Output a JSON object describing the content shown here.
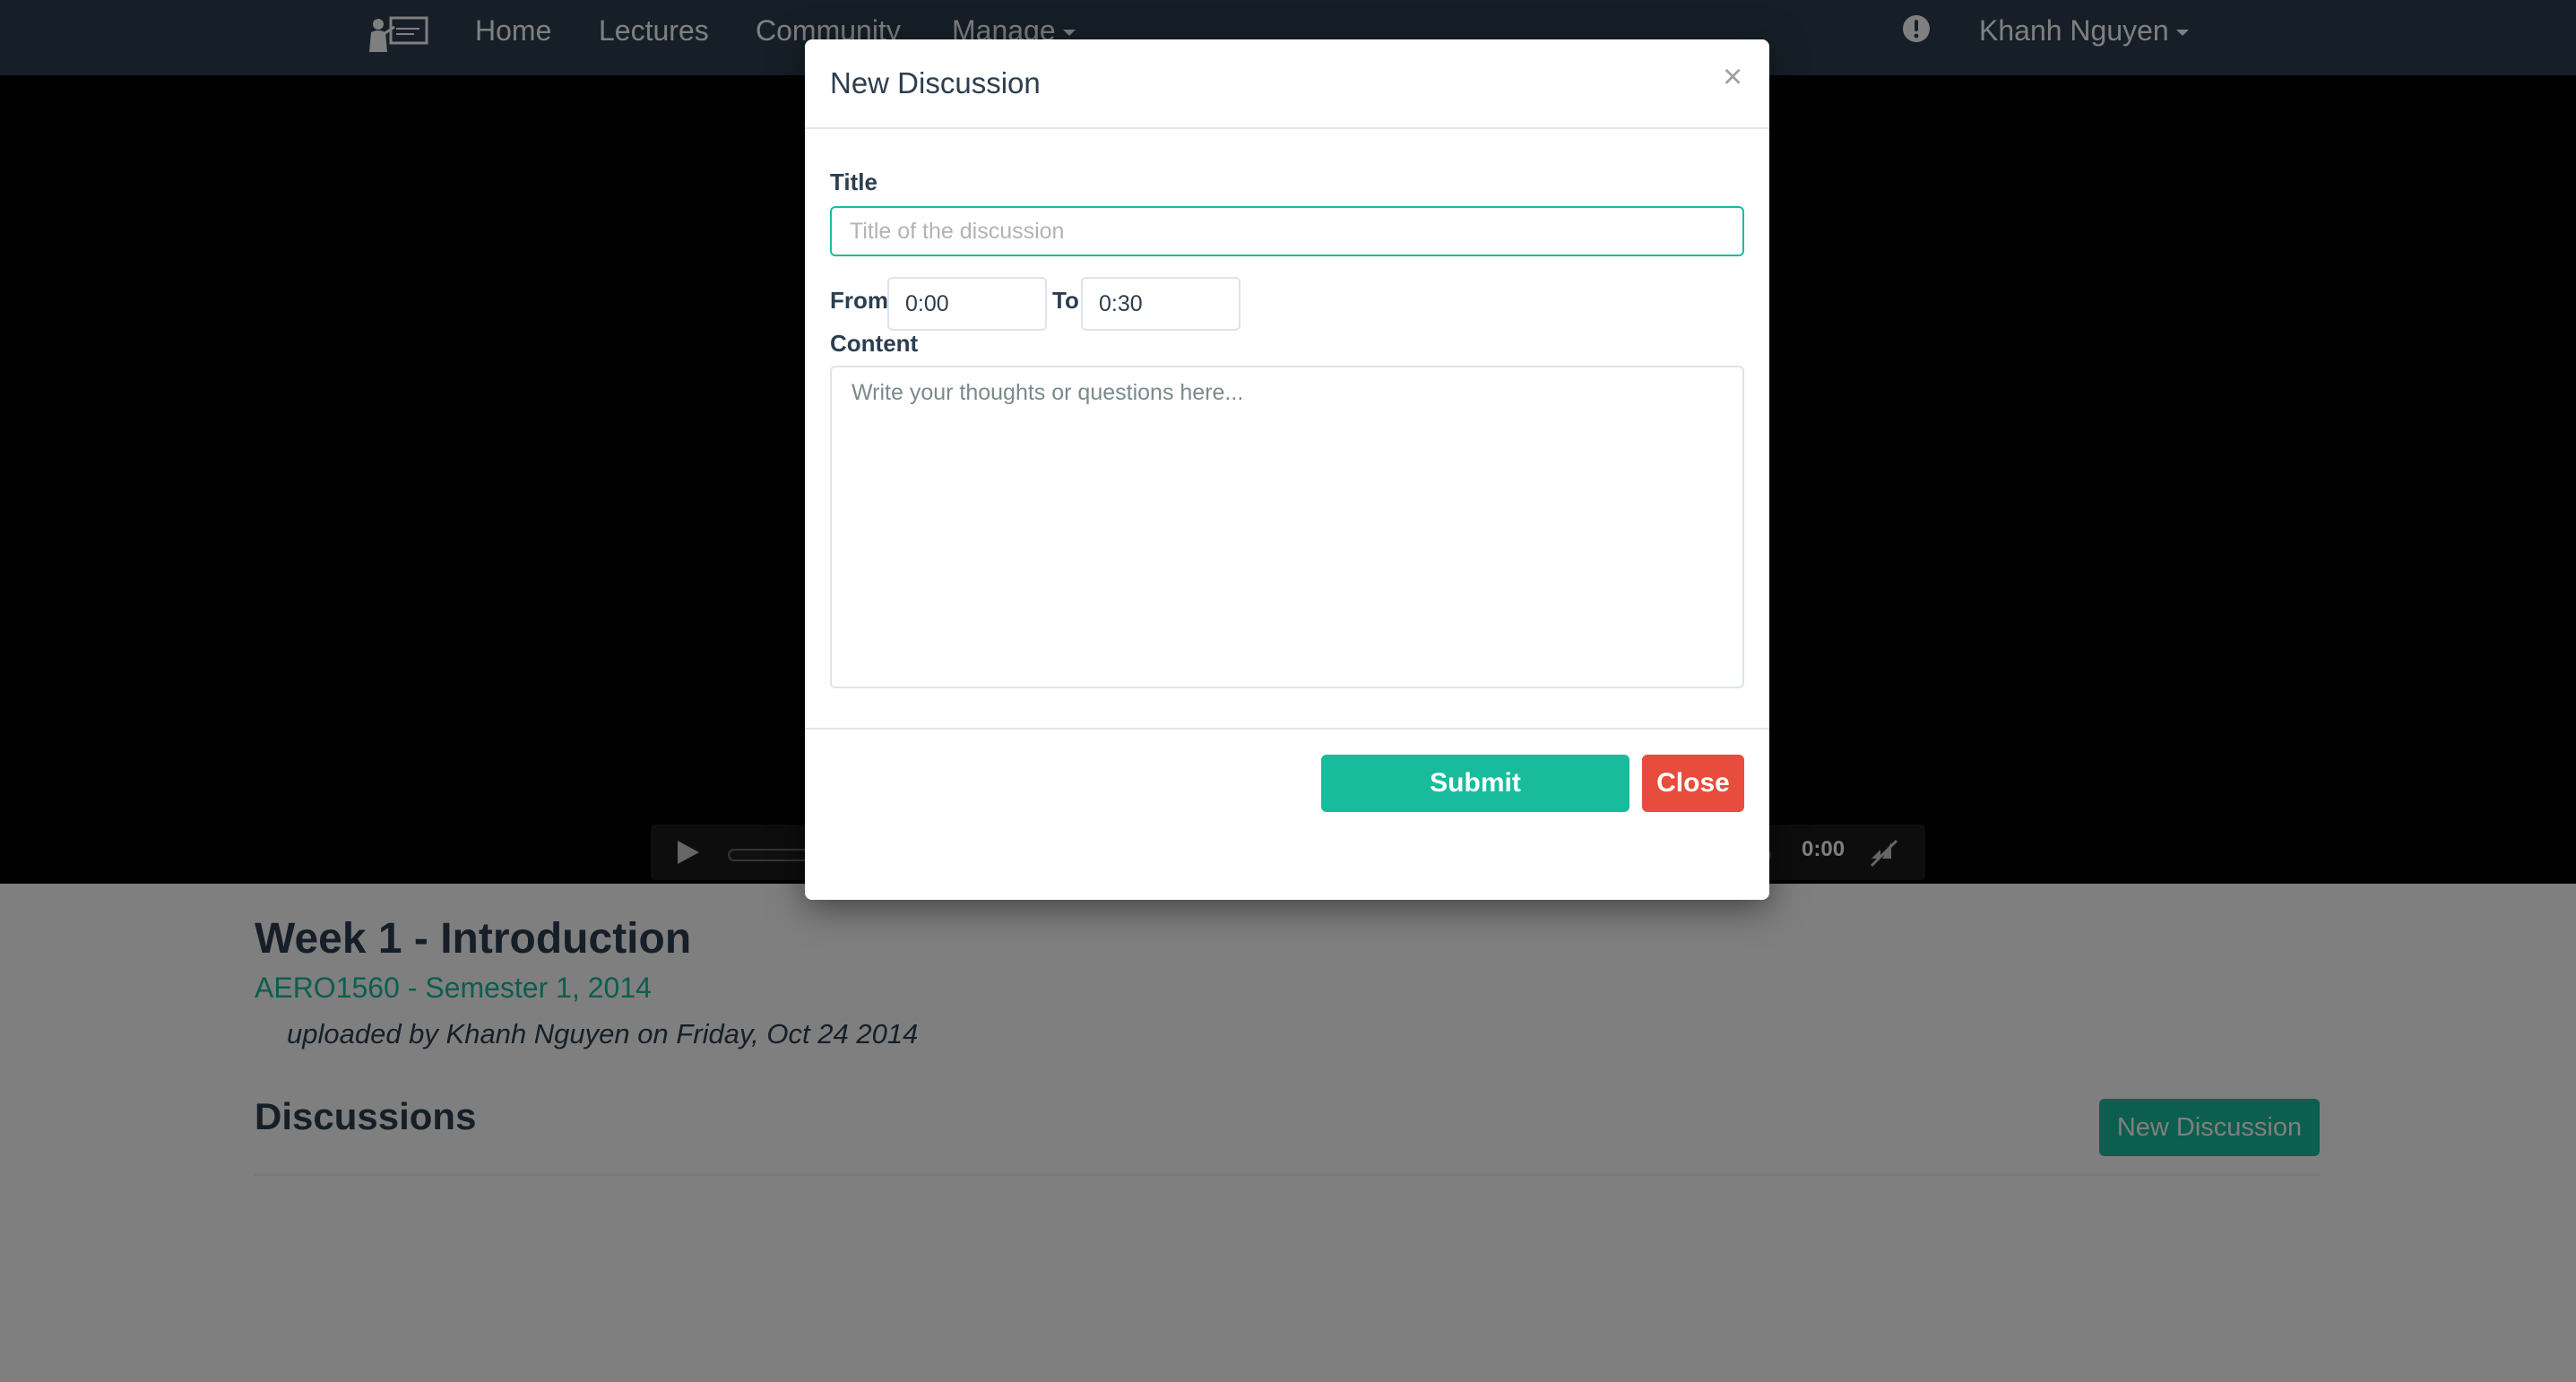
{
  "navbar": {
    "logo_icon": "lecture-presenter-icon",
    "links": [
      "Home",
      "Lectures",
      "Community"
    ],
    "manage_label": "Manage",
    "help_icon": "exclamation-circle-icon",
    "user_name": "Khanh Nguyen"
  },
  "video": {
    "play_icon": "play-icon",
    "time": "0:00",
    "mute_icon": "volume-muted-icon"
  },
  "lecture": {
    "title": "Week 1 - Introduction",
    "course": "AERO1560 - Semester 1, 2014",
    "uploaded": "uploaded by Khanh Nguyen on Friday, Oct 24 2014"
  },
  "discussions": {
    "heading": "Discussions",
    "new_button": "New Discussion"
  },
  "modal": {
    "title": "New Discussion",
    "close_symbol": "×",
    "title_label": "Title",
    "title_placeholder": "Title of the discussion",
    "from_label": "From",
    "from_value": "0:00",
    "to_label": "To",
    "to_value": "0:30",
    "content_label": "Content",
    "content_placeholder": "Write your thoughts or questions here...",
    "submit_label": "Submit",
    "close_label": "Close"
  },
  "colors": {
    "navbar": "#2c3e50",
    "accent": "#18bc9c",
    "danger": "#e74c3c",
    "text": "#2c3e50"
  }
}
